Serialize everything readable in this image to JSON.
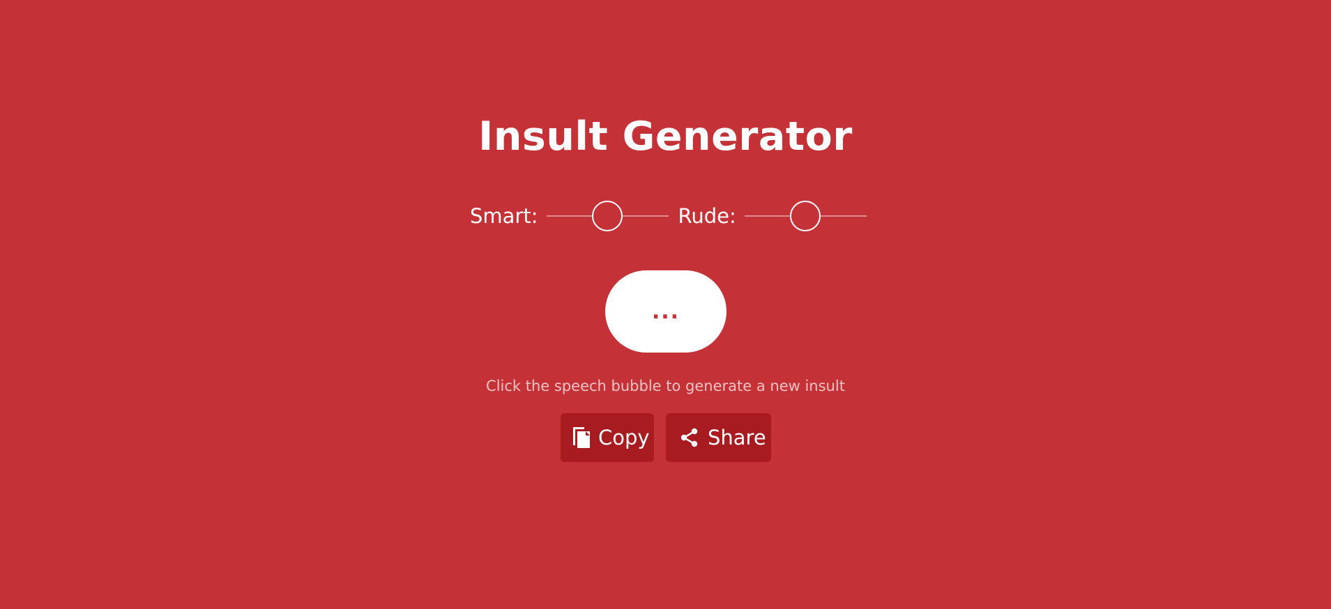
{
  "app": {
    "title": "Insult Generator"
  },
  "controls": {
    "smart": {
      "label": "Smart:",
      "level": 0.5
    },
    "rude": {
      "label": "Rude:",
      "level": 0.5
    }
  },
  "bubble": {
    "text": "..."
  },
  "hint": "Click the speech bubble to generate a new insult",
  "actions": {
    "copy_label": "Copy",
    "share_label": "Share",
    "copy_icon": "copy-icon",
    "share_icon": "share-icon"
  },
  "colors": {
    "background": "#c43237",
    "button": "#a81c21",
    "text": "#ffffff"
  }
}
